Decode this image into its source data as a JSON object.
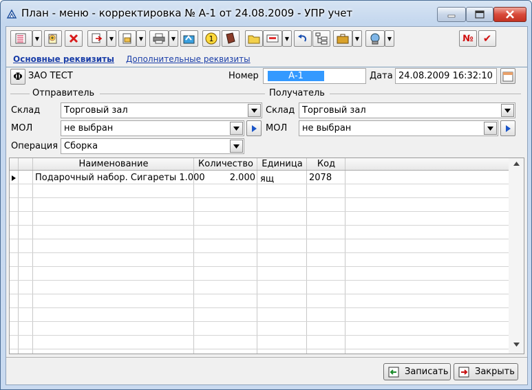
{
  "window": {
    "title": "План - меню - корректировка № А-1 от 24.08.2009 - УПР учет"
  },
  "toolbar": {
    "buttons": [
      "list-icon",
      "new-doc-icon",
      "delete-icon",
      "copy-doc-icon",
      "print-preview-icon",
      "printer-icon",
      "send-icon",
      "circle-one-icon",
      "book-icon",
      "folder-icon",
      "envelope-icon",
      "undo-icon",
      "tree-icon",
      "briefcase-icon",
      "network-icon"
    ],
    "number_button": "№",
    "check_button": "✔"
  },
  "tabs": {
    "main": "Основные реквизиты",
    "additional": "Дополнительные реквизиты"
  },
  "header": {
    "company_button": "Ф",
    "company": "ЗАО ТЕСТ",
    "number_label": "Номер",
    "number_value": "А-1",
    "date_label": "Дата",
    "date_value": "24.08.2009 16:32:10"
  },
  "sender": {
    "title": "Отправитель",
    "warehouse_label": "Склад",
    "warehouse_value": "Торговый зал",
    "mol_label": "МОЛ",
    "mol_value": "не выбран",
    "operation_label": "Операция",
    "operation_value": "Сборка"
  },
  "receiver": {
    "title": "Получатель",
    "warehouse_label": "Склад",
    "warehouse_value": "Торговый зал",
    "mol_label": "МОЛ",
    "mol_value": "не выбран"
  },
  "table": {
    "columns": [
      "Наименование",
      "Количество",
      "Единица",
      "Код"
    ],
    "rows": [
      {
        "name": "Подарочный набор. Сигареты 1.000",
        "qty": "2.000",
        "unit": "ящ",
        "code": "2078"
      }
    ]
  },
  "footer": {
    "save": "Записать",
    "close": "Закрыть"
  }
}
